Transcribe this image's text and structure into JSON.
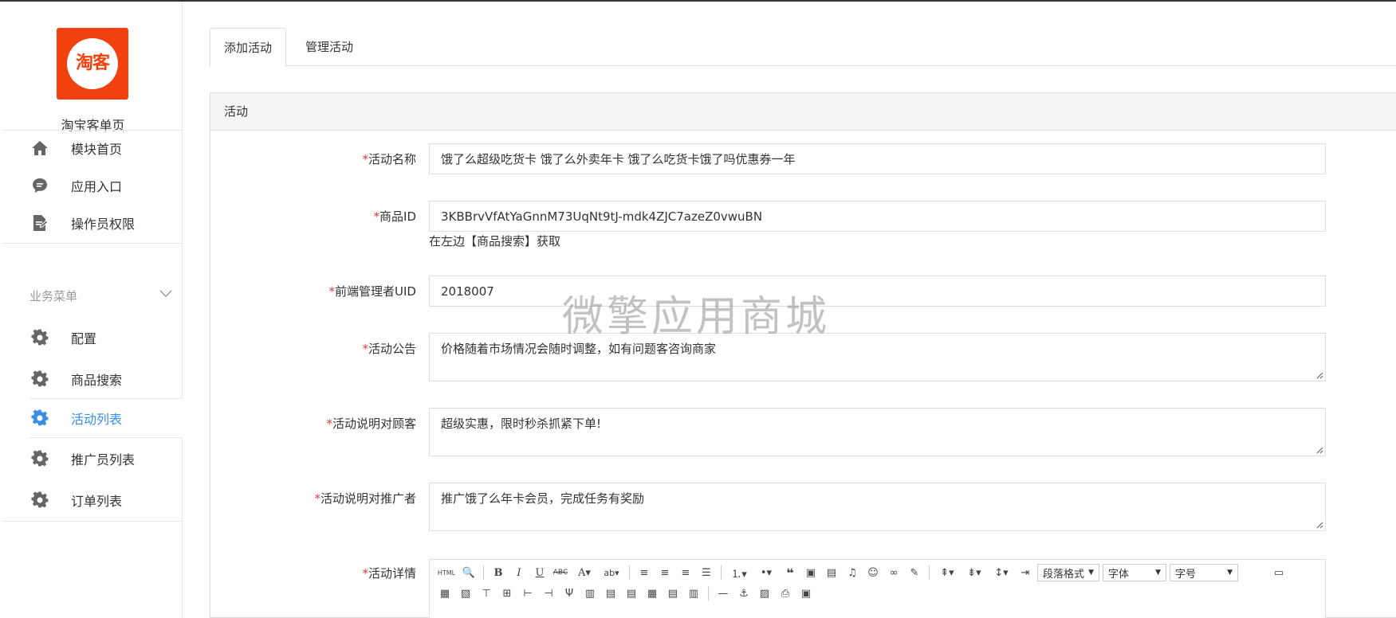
{
  "sidebar": {
    "logo_text": "淘客",
    "app_name": "淘宝客单页",
    "top_items": [
      {
        "label": "模块首页",
        "icon": "home-icon"
      },
      {
        "label": "应用入口",
        "icon": "chat-icon"
      },
      {
        "label": "操作员权限",
        "icon": "document-edit-icon"
      }
    ],
    "group_label": "业务菜单",
    "group_items": [
      {
        "label": "配置",
        "icon": "gear-icon"
      },
      {
        "label": "商品搜索",
        "icon": "gear-icon"
      },
      {
        "label": "活动列表",
        "icon": "gear-icon",
        "active": true
      },
      {
        "label": "推广员列表",
        "icon": "gear-icon"
      },
      {
        "label": "订单列表",
        "icon": "gear-icon"
      }
    ]
  },
  "tabs": [
    {
      "label": "添加活动",
      "active": true
    },
    {
      "label": "管理活动",
      "active": false
    }
  ],
  "panel": {
    "title": "活动",
    "fields": {
      "name": {
        "label": "活动名称",
        "value": "饿了么超级吃货卡 饿了么外卖年卡 饿了么吃货卡饿了吗优惠券一年"
      },
      "goods_id": {
        "label": "商品ID",
        "value": "3KBBrvVfAtYaGnnM73UqNt9tJ-mdk4ZJC7azeZ0vwuBN",
        "help": "在左边【商品搜索】获取"
      },
      "uid": {
        "label": "前端管理者UID",
        "value": "2018007"
      },
      "notice": {
        "label": "活动公告",
        "value": "价格随着市场情况会随时调整，如有问题客咨询商家"
      },
      "desc_customer": {
        "label": "活动说明对顾客",
        "value": "超级实惠，限时秒杀抓紧下单!"
      },
      "desc_promoter": {
        "label": "活动说明对推广者",
        "value": "推广饿了么年卡会员，完成任务有奖励"
      },
      "detail": {
        "label": "活动详情"
      }
    },
    "required_mark": "*"
  },
  "editor": {
    "html_btn": "HTML",
    "paragraph_select": "段落格式",
    "font_select": "字体",
    "size_select": "字号"
  },
  "watermark": "微擎应用商城",
  "colors": {
    "brand": "#f2400f",
    "active": "#3a8ee6",
    "required": "#e4393c"
  }
}
